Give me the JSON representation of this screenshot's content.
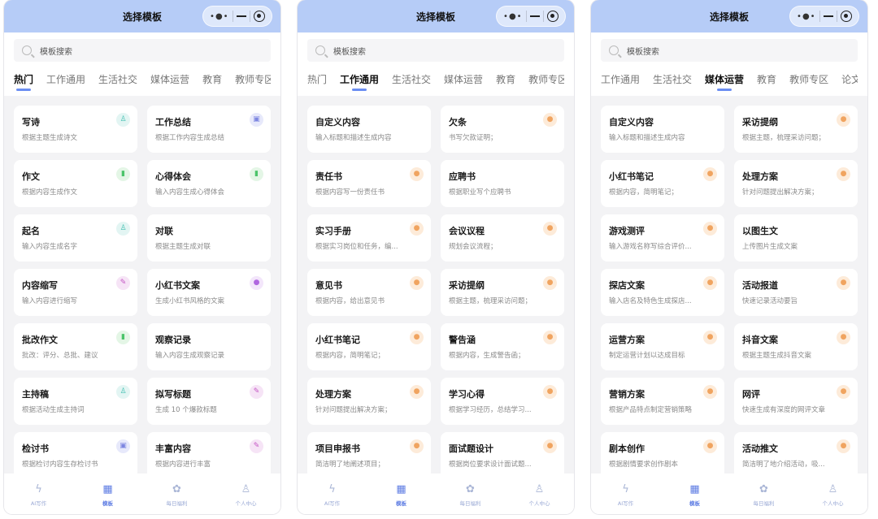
{
  "screens": [
    {
      "title": "选择模板",
      "search_placeholder": "模板搜索",
      "tabs": [
        {
          "label": "热门",
          "active": true
        },
        {
          "label": "工作通用",
          "active": false
        },
        {
          "label": "生活社交",
          "active": false
        },
        {
          "label": "媒体运营",
          "active": false
        },
        {
          "label": "教育",
          "active": false
        },
        {
          "label": "教师专区",
          "active": false
        }
      ],
      "cards": [
        {
          "title": "写诗",
          "desc": "根据主题生成诗文",
          "icon": "person-icon",
          "glyph": "♙",
          "icon_bg": "#e3f5f3",
          "icon_color": "#3fbfb0"
        },
        {
          "title": "工作总结",
          "desc": "根据工作内容生成总结",
          "icon": "briefcase-icon",
          "glyph": "▣",
          "icon_bg": "#e7e9fb",
          "icon_color": "#7d86e0"
        },
        {
          "title": "作文",
          "desc": "根据内容生成作文",
          "icon": "book-icon",
          "glyph": "▮",
          "icon_bg": "#e4f6e6",
          "icon_color": "#4cc46a"
        },
        {
          "title": "心得体会",
          "desc": "输入内容生成心得体会",
          "icon": "book-icon",
          "glyph": "▮",
          "icon_bg": "#e4f6e6",
          "icon_color": "#4cc46a"
        },
        {
          "title": "起名",
          "desc": "输入内容生成名字",
          "icon": "person-icon",
          "glyph": "♙",
          "icon_bg": "#e3f5f3",
          "icon_color": "#3fbfb0"
        },
        {
          "title": "对联",
          "desc": "根据主题生成对联",
          "icon": "",
          "glyph": "",
          "icon_bg": "transparent",
          "icon_color": "#ffffff"
        },
        {
          "title": "内容缩写",
          "desc": "输入内容进行缩写",
          "icon": "pencil-icon",
          "glyph": "✎",
          "icon_bg": "#f6e4f6",
          "icon_color": "#c455c4"
        },
        {
          "title": "小红书文案",
          "desc": "生成小红书风格的文案",
          "icon": "bulb-icon",
          "glyph": "●",
          "icon_bg": "#f3e6fb",
          "icon_color": "#b066e0"
        },
        {
          "title": "批改作文",
          "desc": "批改：评分、总批、建议",
          "icon": "book-icon",
          "glyph": "▮",
          "icon_bg": "#e4f6e6",
          "icon_color": "#4cc46a"
        },
        {
          "title": "观察记录",
          "desc": "输入内容生成观察记录",
          "icon": "",
          "glyph": "",
          "icon_bg": "transparent",
          "icon_color": "#ffffff"
        },
        {
          "title": "主持稿",
          "desc": "根据活动生成主持词",
          "icon": "person-icon",
          "glyph": "♙",
          "icon_bg": "#e3f5f3",
          "icon_color": "#3fbfb0"
        },
        {
          "title": "拟写标题",
          "desc": "生成 10 个爆款标题",
          "icon": "pencil-icon",
          "glyph": "✎",
          "icon_bg": "#f6e4f6",
          "icon_color": "#c455c4"
        },
        {
          "title": "检讨书",
          "desc": "根据检讨内容生存检讨书",
          "icon": "briefcase-icon",
          "glyph": "▣",
          "icon_bg": "#e7e9fb",
          "icon_color": "#7d86e0"
        },
        {
          "title": "丰富内容",
          "desc": "根据内容进行丰富",
          "icon": "pencil-icon",
          "glyph": "✎",
          "icon_bg": "#f6e4f6",
          "icon_color": "#c455c4"
        }
      ]
    },
    {
      "title": "选择模板",
      "search_placeholder": "模板搜索",
      "tabs": [
        {
          "label": "热门",
          "active": false
        },
        {
          "label": "工作通用",
          "active": true
        },
        {
          "label": "生活社交",
          "active": false
        },
        {
          "label": "媒体运营",
          "active": false
        },
        {
          "label": "教育",
          "active": false
        },
        {
          "label": "教师专区",
          "active": false
        }
      ],
      "cards": [
        {
          "title": "自定义内容",
          "desc": "输入标题和描述生成内容",
          "icon": "",
          "glyph": "",
          "icon_bg": "transparent",
          "icon_color": "#ffffff"
        },
        {
          "title": "欠条",
          "desc": "书写欠款证明；",
          "icon": "user-icon",
          "glyph": "●",
          "icon_bg": "#fdebd9",
          "icon_color": "#f0a460"
        },
        {
          "title": "责任书",
          "desc": "根据内容写一份责任书",
          "icon": "user-icon",
          "glyph": "●",
          "icon_bg": "#fdebd9",
          "icon_color": "#f0a460"
        },
        {
          "title": "应聘书",
          "desc": "根据职业写个应聘书",
          "icon": "",
          "glyph": "",
          "icon_bg": "transparent",
          "icon_color": "#ffffff"
        },
        {
          "title": "实习手册",
          "desc": "根据实习岗位和任务，编...",
          "icon": "user-icon",
          "glyph": "●",
          "icon_bg": "#fdebd9",
          "icon_color": "#f0a460"
        },
        {
          "title": "会议议程",
          "desc": "规划会议流程；",
          "icon": "user-icon",
          "glyph": "●",
          "icon_bg": "#fdebd9",
          "icon_color": "#f0a460"
        },
        {
          "title": "意见书",
          "desc": "根据内容，给出意见书",
          "icon": "user-icon",
          "glyph": "●",
          "icon_bg": "#fdebd9",
          "icon_color": "#f0a460"
        },
        {
          "title": "采访提纲",
          "desc": "根据主题，梳理采访问题；",
          "icon": "user-icon",
          "glyph": "●",
          "icon_bg": "#fdebd9",
          "icon_color": "#f0a460"
        },
        {
          "title": "小红书笔记",
          "desc": "根据内容，简明笔记；",
          "icon": "user-icon",
          "glyph": "●",
          "icon_bg": "#fdebd9",
          "icon_color": "#f0a460"
        },
        {
          "title": "警告涵",
          "desc": "根据内容，生成警告函；",
          "icon": "user-icon",
          "glyph": "●",
          "icon_bg": "#fdebd9",
          "icon_color": "#f0a460"
        },
        {
          "title": "处理方案",
          "desc": "针对问题提出解决方案；",
          "icon": "user-icon",
          "glyph": "●",
          "icon_bg": "#fdebd9",
          "icon_color": "#f0a460"
        },
        {
          "title": "学习心得",
          "desc": "根据学习经历，总结学习...",
          "icon": "user-icon",
          "glyph": "●",
          "icon_bg": "#fdebd9",
          "icon_color": "#f0a460"
        },
        {
          "title": "项目申报书",
          "desc": "简洁明了地阐述项目；",
          "icon": "user-icon",
          "glyph": "●",
          "icon_bg": "#fdebd9",
          "icon_color": "#f0a460"
        },
        {
          "title": "面试题设计",
          "desc": "根据岗位要求设计面试题...",
          "icon": "user-icon",
          "glyph": "●",
          "icon_bg": "#fdebd9",
          "icon_color": "#f0a460"
        }
      ]
    },
    {
      "title": "选择模板",
      "search_placeholder": "模板搜索",
      "tabs": [
        {
          "label": "工作通用",
          "active": false
        },
        {
          "label": "生活社交",
          "active": false
        },
        {
          "label": "媒体运营",
          "active": true
        },
        {
          "label": "教育",
          "active": false
        },
        {
          "label": "教师专区",
          "active": false
        },
        {
          "label": "论文",
          "active": false
        }
      ],
      "cards": [
        {
          "title": "自定义内容",
          "desc": "输入标题和描述生成内容",
          "icon": "",
          "glyph": "",
          "icon_bg": "transparent",
          "icon_color": "#ffffff"
        },
        {
          "title": "采访提纲",
          "desc": "根据主题，梳理采访问题；",
          "icon": "user-icon",
          "glyph": "●",
          "icon_bg": "#fdebd9",
          "icon_color": "#f0a460"
        },
        {
          "title": "小红书笔记",
          "desc": "根据内容，简明笔记；",
          "icon": "user-icon",
          "glyph": "●",
          "icon_bg": "#fdebd9",
          "icon_color": "#f0a460"
        },
        {
          "title": "处理方案",
          "desc": "针对问题提出解决方案；",
          "icon": "user-icon",
          "glyph": "●",
          "icon_bg": "#fdebd9",
          "icon_color": "#f0a460"
        },
        {
          "title": "游戏测评",
          "desc": "输入游戏名称写综合评价...",
          "icon": "user-icon",
          "glyph": "●",
          "icon_bg": "#fdebd9",
          "icon_color": "#f0a460"
        },
        {
          "title": "以图生文",
          "desc": "上传图片生成文案",
          "icon": "",
          "glyph": "",
          "icon_bg": "transparent",
          "icon_color": "#ffffff"
        },
        {
          "title": "探店文案",
          "desc": "输入店名及特色生成探店...",
          "icon": "user-icon",
          "glyph": "●",
          "icon_bg": "#fdebd9",
          "icon_color": "#f0a460"
        },
        {
          "title": "活动报道",
          "desc": "快速记录活动要旨",
          "icon": "user-icon",
          "glyph": "●",
          "icon_bg": "#fdebd9",
          "icon_color": "#f0a460"
        },
        {
          "title": "运营方案",
          "desc": "制定运营计划以达成目标",
          "icon": "user-icon",
          "glyph": "●",
          "icon_bg": "#fdebd9",
          "icon_color": "#f0a460"
        },
        {
          "title": "抖音文案",
          "desc": "根据主题生成抖音文案",
          "icon": "user-icon",
          "glyph": "●",
          "icon_bg": "#fdebd9",
          "icon_color": "#f0a460"
        },
        {
          "title": "营销方案",
          "desc": "根据产品特点制定营销策略",
          "icon": "user-icon",
          "glyph": "●",
          "icon_bg": "#fdebd9",
          "icon_color": "#f0a460"
        },
        {
          "title": "网评",
          "desc": "快速生成有深度的网评文章",
          "icon": "user-icon",
          "glyph": "●",
          "icon_bg": "#fdebd9",
          "icon_color": "#f0a460"
        },
        {
          "title": "剧本创作",
          "desc": "根据剧情要求创作剧本",
          "icon": "user-icon",
          "glyph": "●",
          "icon_bg": "#fdebd9",
          "icon_color": "#f0a460"
        },
        {
          "title": "活动推文",
          "desc": "简洁明了地介绍活动，吸...",
          "icon": "user-icon",
          "glyph": "●",
          "icon_bg": "#fdebd9",
          "icon_color": "#f0a460"
        }
      ]
    }
  ],
  "bottom_nav": [
    {
      "label": "AI写作",
      "icon": "lightning-icon",
      "glyph": "ϟ",
      "active": false
    },
    {
      "label": "模板",
      "icon": "grid-icon",
      "glyph": "▦",
      "active": true
    },
    {
      "label": "每日福利",
      "icon": "gift-icon",
      "glyph": "✿",
      "active": false
    },
    {
      "label": "个人中心",
      "icon": "user-icon",
      "glyph": "♙",
      "active": false
    }
  ],
  "colors": {
    "titlebar": "#b6ccf7",
    "accent": "#5f7de3",
    "background": "#f3f3f5"
  }
}
